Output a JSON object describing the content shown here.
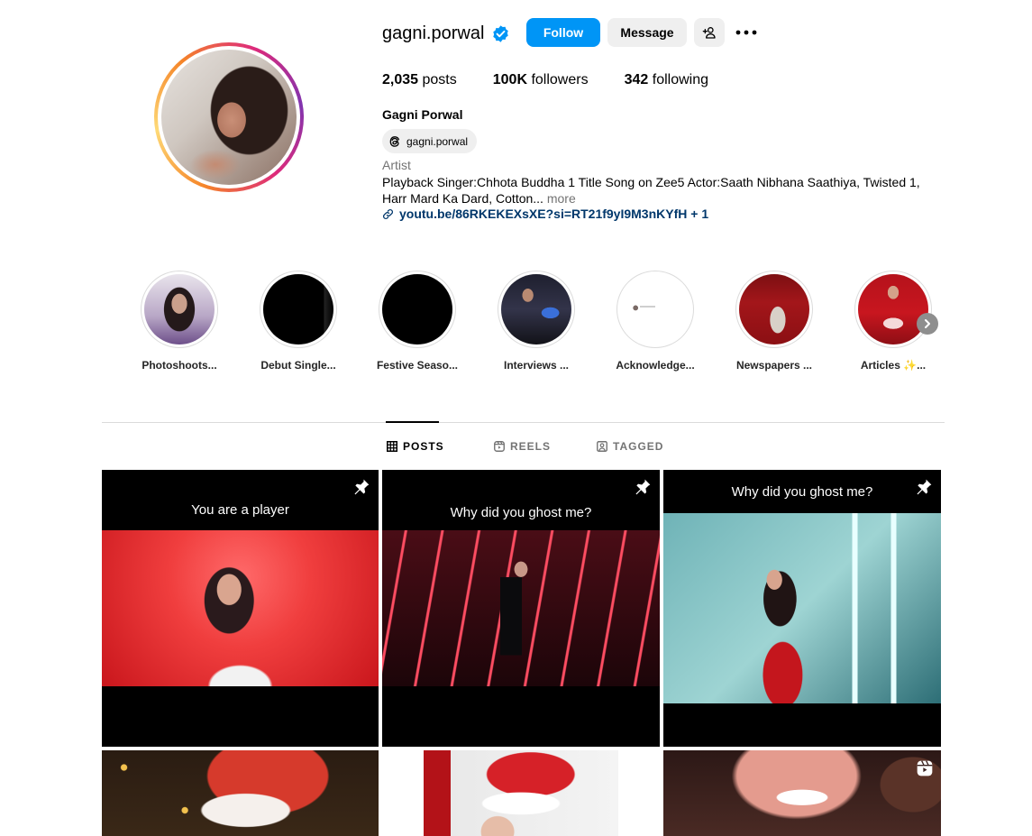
{
  "profile": {
    "username": "gagni.porwal",
    "follow_label": "Follow",
    "message_label": "Message",
    "stats": {
      "posts_count": "2,035",
      "posts_label": "posts",
      "followers_count": "100K",
      "followers_label": "followers",
      "following_count": "342",
      "following_label": "following"
    },
    "full_name": "Gagni Porwal",
    "threads_handle": "gagni.porwal",
    "category": "Artist",
    "bio": "Playback Singer:Chhota Buddha 1 Title Song on Zee5 Actor:Saath Nibhana Saathiya, Twisted 1, Harr Mard Ka Dard, Cotton...",
    "bio_more": "more",
    "link": "youtu.be/86RKEKEXsXE?si=RT21f9yI9M3nKYfH + 1"
  },
  "highlights": [
    {
      "label": "Photoshoots..."
    },
    {
      "label": "Debut Single..."
    },
    {
      "label": "Festive Seaso..."
    },
    {
      "label": "Interviews ..."
    },
    {
      "label": "Acknowledge..."
    },
    {
      "label": "Newspapers ..."
    },
    {
      "label": "Articles ✨..."
    }
  ],
  "tabs": {
    "posts": "POSTS",
    "reels": "REELS",
    "tagged": "TAGGED",
    "active": "posts"
  },
  "posts": [
    {
      "caption": "You are a player"
    },
    {
      "caption": "Why did you ghost me?"
    },
    {
      "caption": "Why did you ghost me?"
    }
  ],
  "colors": {
    "follow_button": "#0095f6",
    "link": "#00376b",
    "verified_badge": "#0095f6"
  }
}
